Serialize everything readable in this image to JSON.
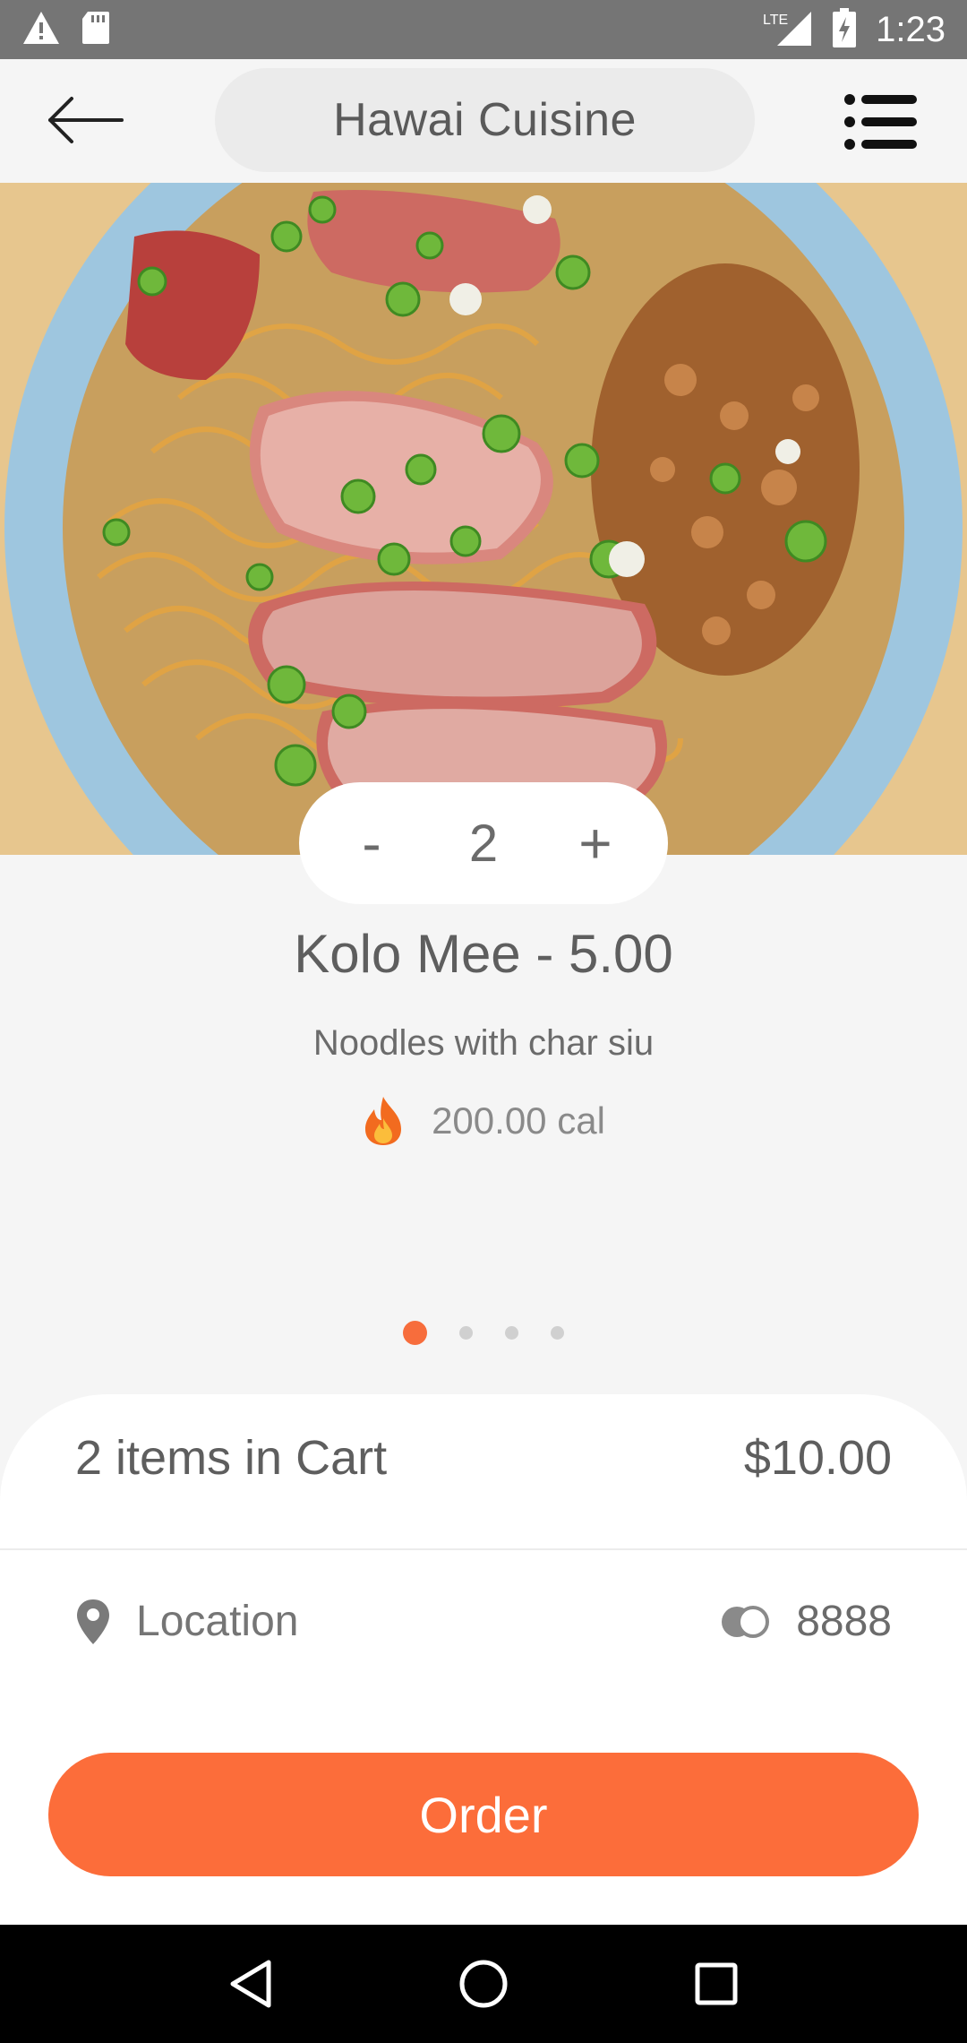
{
  "status_bar": {
    "time": "1:23",
    "network": "LTE",
    "icons": [
      "warning-icon",
      "sd-card-icon",
      "signal-icon",
      "battery-charging-icon"
    ]
  },
  "header": {
    "title": "Hawai Cuisine",
    "back_icon": "arrow-left-icon",
    "menu_icon": "list-menu-icon"
  },
  "dish": {
    "quantity": "2",
    "decrement_label": "-",
    "increment_label": "+",
    "name": "Kolo Mee - 5.00",
    "description": "Noodles with char siu",
    "calories": "200.00 cal",
    "calorie_icon": "fire-icon"
  },
  "pager": {
    "count": 4,
    "active_index": 0
  },
  "cart": {
    "summary": "2 items in Cart",
    "total": "$10.00"
  },
  "location": {
    "label": "Location",
    "code": "8888",
    "location_icon": "map-pin-icon",
    "code_icon": "coins-icon"
  },
  "order_button": {
    "label": "Order"
  },
  "nav_bar": {
    "icons": [
      "back-triangle-icon",
      "home-circle-icon",
      "recents-square-icon"
    ]
  },
  "colors": {
    "accent": "#fc6d3a",
    "background": "#f5f5f5",
    "status_bar": "#757575",
    "nav_bar": "#000000"
  }
}
